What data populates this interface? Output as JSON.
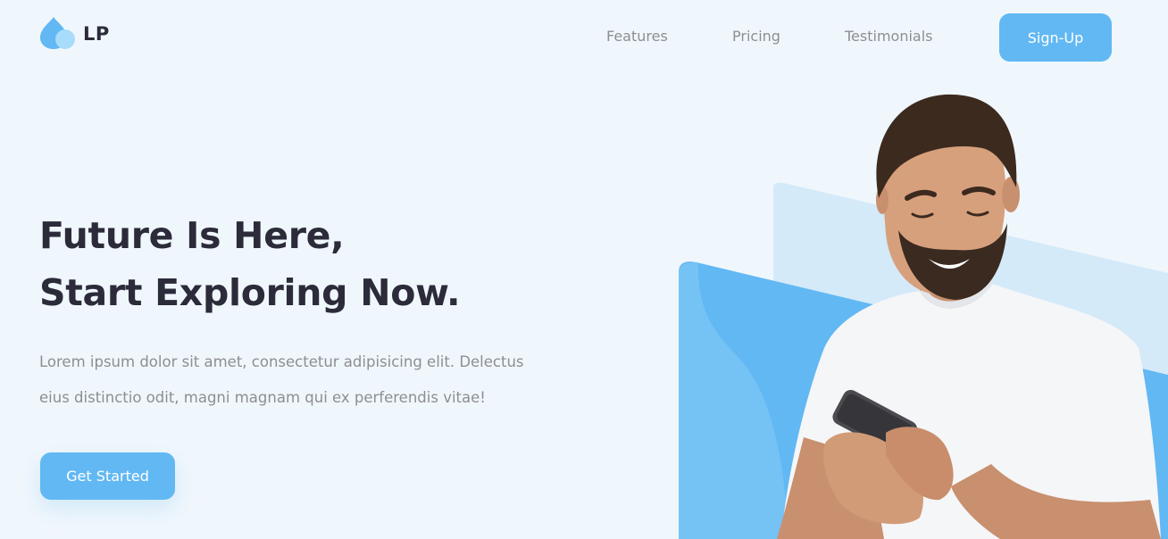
{
  "brand": {
    "logo_text": "LP",
    "logo_icon": "water-drop-icon"
  },
  "nav": {
    "links": [
      {
        "label": "Features"
      },
      {
        "label": "Pricing"
      },
      {
        "label": "Testimonials"
      }
    ],
    "signup_label": "Sign-Up"
  },
  "hero": {
    "title_line1": "Future Is Here,",
    "title_line2": "Start Exploring Now.",
    "body_line1": "Lorem ipsum dolor sit amet, consectetur adipisicing elit. Delectus",
    "body_line2": "eius distinctio odit, magni magnam qui ex perferendis vitae!",
    "cta_label": "Get Started",
    "illustration": "man-smiling-at-phone-photo"
  },
  "colors": {
    "background": "#f0f7fc",
    "accent": "#62b8f3",
    "accent_light": "#d4eaf9",
    "heading": "#2b2b3a",
    "muted_text": "#8d8e94"
  }
}
